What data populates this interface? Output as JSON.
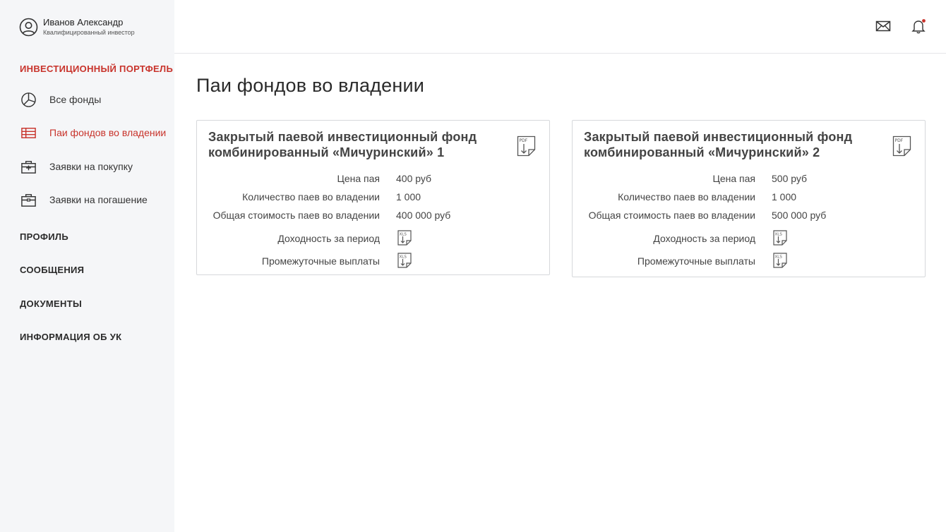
{
  "user": {
    "name": "Иванов Александр",
    "role": "Квалифицированный инвестор"
  },
  "sidebar": {
    "portfolio_title": "ИНВЕСТИЦИОННЫЙ ПОРТФЕЛЬ",
    "items": [
      {
        "label": "Все фонды",
        "icon": "pie-chart-icon"
      },
      {
        "label": "Паи фондов во владении",
        "icon": "table-icon",
        "active": true
      },
      {
        "label": "Заявки на покупку",
        "icon": "briefcase-plus-icon"
      },
      {
        "label": "Заявки на погашение",
        "icon": "briefcase-icon"
      }
    ],
    "sections": [
      "ПРОФИЛЬ",
      "СООБЩЕНИЯ",
      "ДОКУМЕНТЫ",
      "ИНФОРМАЦИЯ ОБ УК"
    ]
  },
  "topbar": {
    "icons": [
      "mail-icon",
      "bell-icon"
    ]
  },
  "colors": {
    "accent": "#c8332b",
    "sidebar_bg": "#f5f6f8"
  },
  "main": {
    "title": "Паи фондов во владении",
    "cards": [
      {
        "title": "Закрытый паевой инвестиционный фонд комбинированный «Мичуринский» 1",
        "price_label": "Цена пая",
        "price": "400 руб",
        "count_label": "Количество паев во владении",
        "count": "1 000",
        "total_label": "Общая стоимость паев во владении",
        "total": "400 000 руб",
        "yield_label": "Доходность за период",
        "payments_label": "Промежуточные выплаты"
      },
      {
        "title": "Закрытый паевой инвестиционный фонд комбинированный «Мичуринский» 2",
        "price_label": "Цена пая",
        "price": "500 руб",
        "count_label": "Количество паев во владении",
        "count": "1 000",
        "total_label": "Общая стоимость паев во владении",
        "total": "500 000 руб",
        "yield_label": "Доходность за период",
        "payments_label": "Промежуточные выплаты"
      }
    ]
  }
}
